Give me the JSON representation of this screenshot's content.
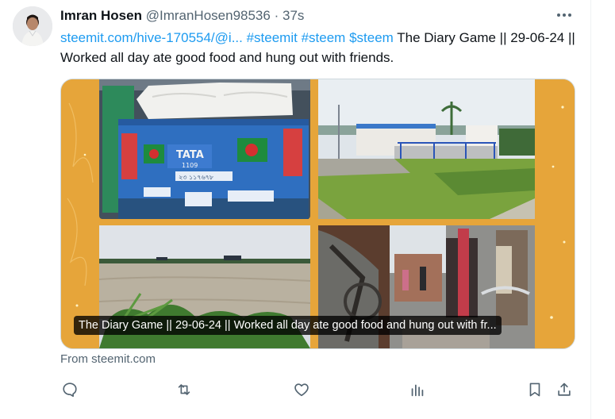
{
  "author": {
    "name": "Imran Hosen",
    "handle": "@ImranHosen98536",
    "separator": "·",
    "time": "37s"
  },
  "tweet": {
    "link": "steemit.com/hive-170554/@i...",
    "hashtags": [
      "#steemit",
      "#steem"
    ],
    "cashtag": "$steem",
    "text": "The Diary Game || 29-06-24 || Worked all day ate good food and hung out with friends."
  },
  "card": {
    "caption": "The Diary Game || 29-06-24 || Worked all day ate good food and hung out with fr...",
    "truck_text": {
      "brand": "TATA",
      "model": "1109",
      "plate": "২৩ ১১৭৬৭৮"
    },
    "colors": {
      "border": "#e6a53a",
      "truck": "#2f6fc0"
    }
  },
  "source": "From steemit.com",
  "colors": {
    "link": "#1d9bf0",
    "muted": "#536471",
    "text": "#0f1419"
  },
  "icons": [
    "more-icon",
    "reply-icon",
    "retweet-icon",
    "like-icon",
    "views-icon",
    "bookmark-icon",
    "share-icon"
  ]
}
